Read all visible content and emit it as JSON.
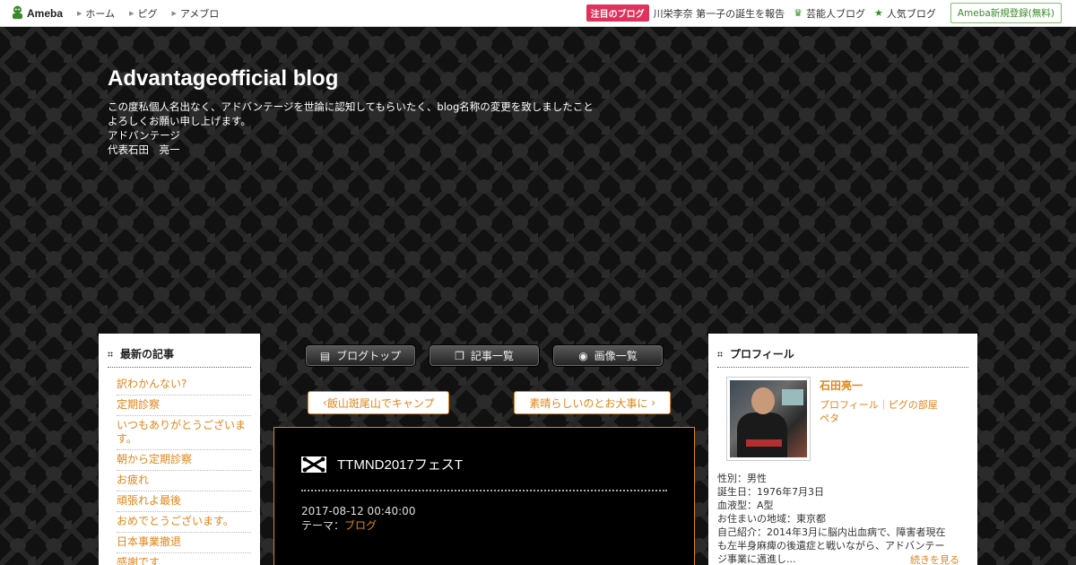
{
  "topbar": {
    "logo_text": "Ameba",
    "nav": [
      "ホーム",
      "ピグ",
      "アメブロ"
    ],
    "hot_badge": "注目のブログ",
    "hot_text": "川栄李奈 第一子の誕生を報告",
    "celebrity_label": "芸能人ブログ",
    "popular_label": "人気ブログ",
    "signup_label": "Ameba新規登録(無料)"
  },
  "header": {
    "title": "Advantageofficial blog",
    "desc_lines": [
      "この度私個人名出なく、アドバンテージを世論に認知してもらいたく、blog名称の変更を致しましたこと",
      "よろしくお願い申し上げます。",
      "アドバンテージ",
      "代表石田　亮一"
    ]
  },
  "recent": {
    "title": "最新の記事",
    "items": [
      "訳わかんない?",
      "定期診察",
      "いつもありがとうございます。",
      "朝から定期診察",
      "お疲れ",
      "頑張れよ最後",
      "おめでとうございます。",
      "日本事業撤退",
      "感謝です"
    ]
  },
  "tabs": {
    "top": "ブログトップ",
    "list": "記事一覧",
    "images": "画像一覧"
  },
  "pager": {
    "prev": "飯山斑尾山でキャンプ",
    "next": "素晴らしいのとお大事に"
  },
  "entry": {
    "title": "TTMND2017フェスT",
    "datetime": "2017-08-12 00:40:00",
    "theme_label": "テーマ：",
    "theme": "ブログ"
  },
  "profile": {
    "title": "プロフィール",
    "name": "石田亮一",
    "links": "プロフィール｜ピグの部屋",
    "links2": "ペタ",
    "details": [
      "性別：男性",
      "誕生日：1976年7月3日",
      "血液型：A型",
      "お住まいの地域：東京都",
      "自己紹介：2014年3月に脳内出血病で、障害者現在",
      "も左半身麻痺の後遺症と戦いながら、アドバンテー",
      "ジ事業に邁進し..."
    ],
    "more": "続きを見る"
  },
  "colors": {
    "accent": "#e0851a",
    "hot_badge": "#e0325c",
    "ameba_green": "#3a8a2a"
  }
}
